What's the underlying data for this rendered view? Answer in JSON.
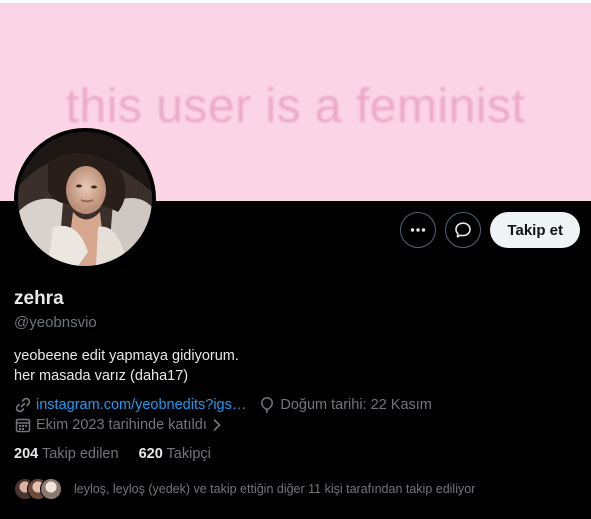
{
  "banner": {
    "text": "this user is a feminist",
    "bg_color": "#fbd5e6"
  },
  "actions": {
    "more_icon": "more-horizontal-icon",
    "message_icon": "message-bubble-icon",
    "follow_label": "Takip et"
  },
  "profile": {
    "name": "zehra",
    "handle": "@yeobnsvio",
    "bio_line1": "yeobeene edit yapmaya gidiyorum.",
    "bio_line2": "her masada varız (daha17)"
  },
  "meta": {
    "link_text": "instagram.com/yeobnedits?igs…",
    "birthday": "Doğum tarihi: 22 Kasım",
    "joined": "Ekim 2023 tarihinde katıldı"
  },
  "counts": {
    "following_value": "204",
    "following_label": "Takip edilen",
    "followers_value": "620",
    "followers_label": "Takipçi"
  },
  "followed_by": {
    "text": "leyloş, leyloş (yedek) ve takip ettiğin diğer 11 kişi tarafından takip ediliyor"
  },
  "colors": {
    "link": "#1d9bf0",
    "muted": "#71767b",
    "text": "#e7e9ea",
    "background": "#000000"
  }
}
